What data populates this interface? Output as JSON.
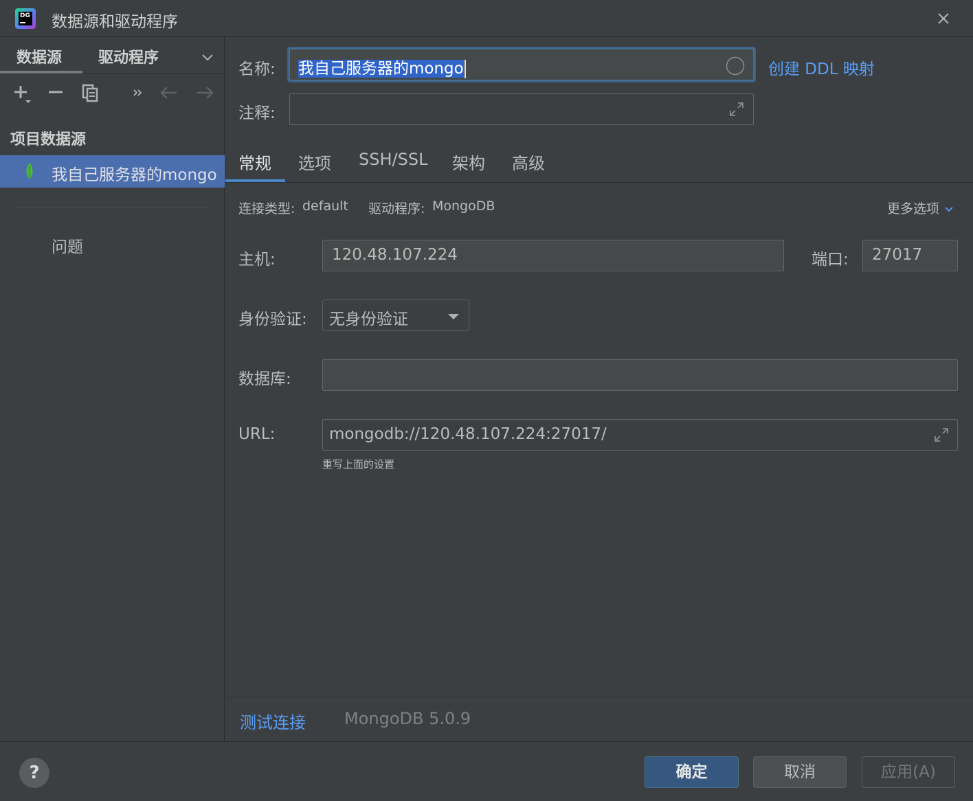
{
  "window": {
    "title": "数据源和驱动程序"
  },
  "left_panel": {
    "tabs": [
      "数据源",
      "驱动程序"
    ],
    "section_header": "项目数据源",
    "selected_item": "我自己服务器的mongo",
    "problems_label": "问题"
  },
  "form": {
    "name_label": "名称:",
    "name_value": "我自己服务器的mongo",
    "create_ddl_link": "创建 DDL 映射",
    "comment_label": "注释:",
    "comment_value": ""
  },
  "tabs": [
    "常规",
    "选项",
    "SSH/SSL",
    "架构",
    "高级"
  ],
  "general": {
    "conn_type_label": "连接类型:",
    "conn_type_value": "default",
    "driver_label": "驱动程序:",
    "driver_value": "MongoDB",
    "more_options": "更多选项",
    "host_label": "主机:",
    "host_value": "120.48.107.224",
    "port_label": "端口:",
    "port_value": "27017",
    "auth_label": "身份验证:",
    "auth_value": "无身份验证",
    "database_label": "数据库:",
    "database_value": "",
    "url_label": "URL:",
    "url_value": "mongodb://120.48.107.224:27017/",
    "url_hint": "重写上面的设置"
  },
  "status": {
    "test_connection": "测试连接",
    "driver_version": "MongoDB 5.0.9"
  },
  "footer": {
    "help": "?",
    "ok": "确定",
    "cancel": "取消",
    "apply": "应用(A)"
  },
  "colors": {
    "background": "#3c3f41",
    "selection": "#4b6eaf",
    "link": "#589df6",
    "focus": "#466d94",
    "mongo_leaf": "#4db33d"
  }
}
